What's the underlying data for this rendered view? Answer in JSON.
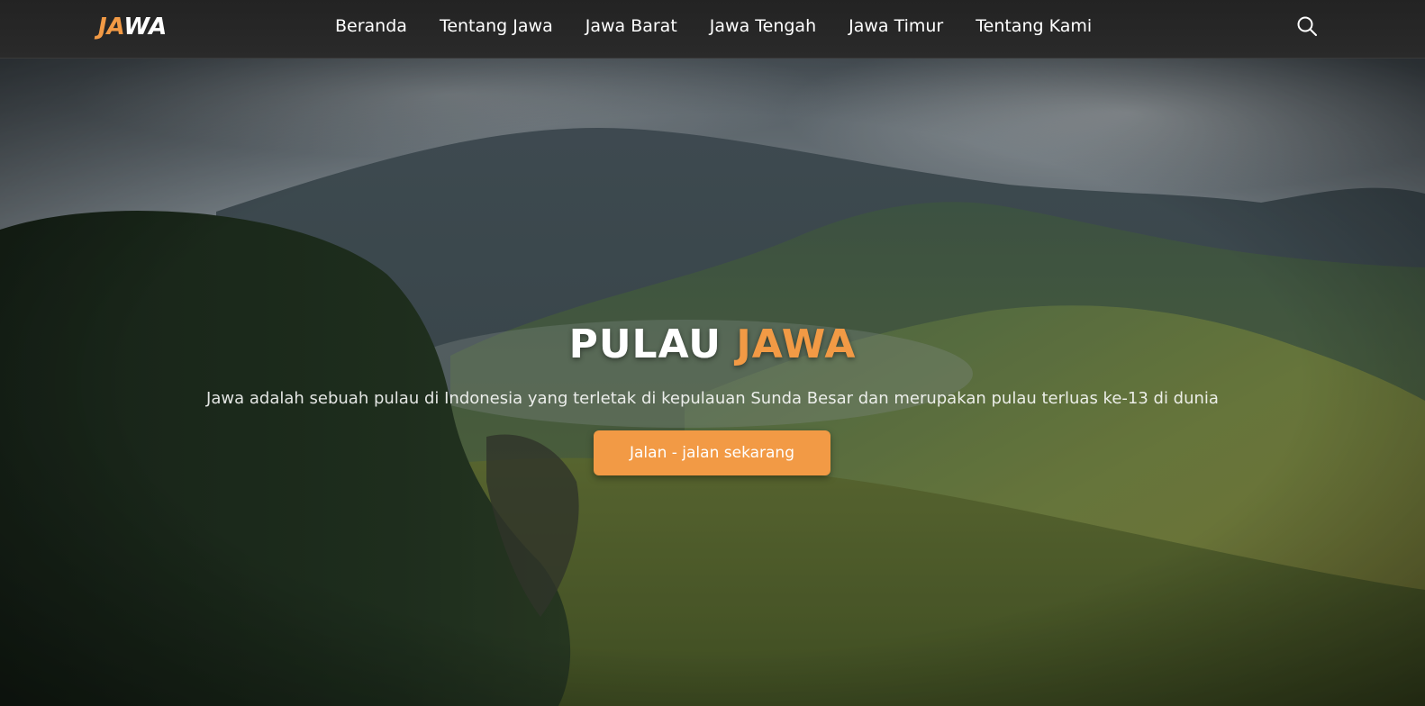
{
  "navbar": {
    "logo": {
      "part1": "JA",
      "part2": "WA"
    },
    "links": [
      {
        "label": "Beranda"
      },
      {
        "label": "Tentang Jawa"
      },
      {
        "label": "Jawa Barat"
      },
      {
        "label": "Jawa Tengah"
      },
      {
        "label": "Jawa Timur"
      },
      {
        "label": "Tentang Kami"
      }
    ],
    "search_icon": "search-icon"
  },
  "hero": {
    "title_main": "PULAU ",
    "title_accent": "JAWA",
    "subtitle": "Jawa adalah sebuah pulau di Indonesia yang terletak di kepulauan Sunda Besar dan merupakan pulau terluas ke-13 di dunia",
    "button_label": "Jalan - jalan sekarang"
  },
  "colors": {
    "accent": "#f29a45",
    "navbar_bg": "#252525",
    "text": "#ffffff"
  }
}
